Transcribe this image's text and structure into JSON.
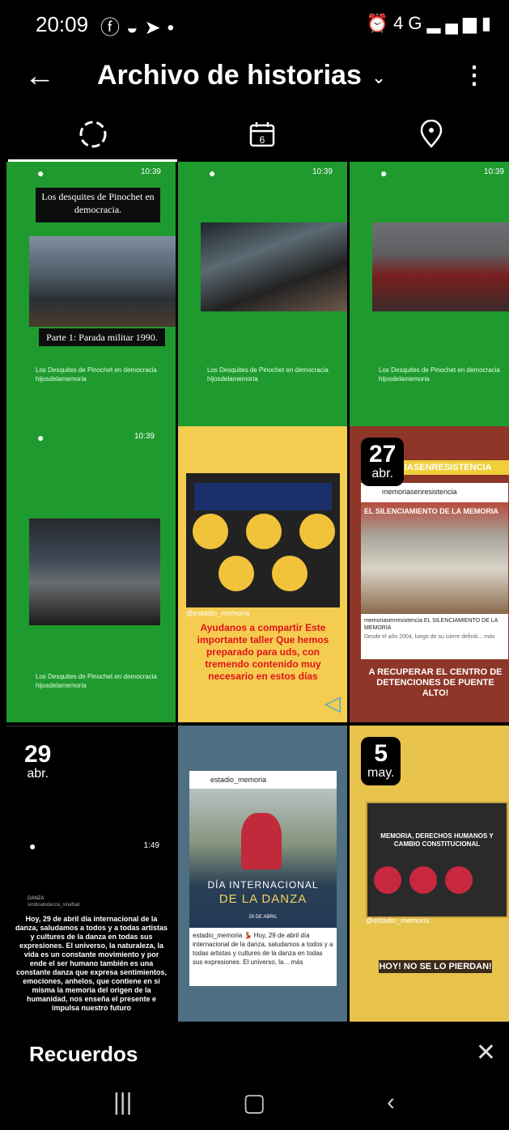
{
  "status": {
    "time": "20:09",
    "left_icons": [
      "facebook-icon",
      "messenger-icon",
      "telegram-icon"
    ],
    "right_icons": [
      "alarm-icon",
      "4g-icon",
      "signal-icon",
      "battery-icon"
    ],
    "net": "4G"
  },
  "appbar": {
    "title": "Archivo de historias"
  },
  "tabs": [
    {
      "name": "stories",
      "icon": "loading-icon"
    },
    {
      "name": "calendar",
      "icon": "calendar-icon",
      "label": "6"
    },
    {
      "name": "map",
      "icon": "location-pin-icon"
    }
  ],
  "grid": {
    "c1": {
      "header": "Los desquites de Pinochet en democracia.",
      "footer": "Parte 1: Parada militar 1990.",
      "caption": "Los Desquites de Pinochet en democracia",
      "user": "hijosdelamemoria",
      "time": "10:39"
    },
    "c2": {
      "caption": "Los Desquites de Pinochet en democracia",
      "user": "hijosdelamemoria",
      "time": "10:39"
    },
    "c3": {
      "caption": "Los Desquites de Pinochet en democracia",
      "user": "hijosdelamemoria",
      "time": "10:39"
    },
    "c4": {
      "caption": "Los Desquites de Pinochet en democracia",
      "user": "hijosdelamemoria",
      "time": "10:39"
    },
    "c5": {
      "user": "@estadio_memoria",
      "text": "Ayudanos a compartir Este importante taller Que hemos preparado para uds, con tremendo contenido muy necesario en estos días"
    },
    "c6": {
      "badge_day": "27",
      "badge_month": "abr.",
      "banner": "RIASENRESISTENCIA",
      "account": "memoriasenresistencia",
      "headline": "EL SILENCIAMIENTO DE LA MEMORIA",
      "bottom": "A RECUPERAR EL CENTRO DE DETENCIONES DE PUENTE ALTO!",
      "desc": "memoriasenresistencia EL SILENCIAMIENTO DE LA MEMORIA",
      "more": "Desde el año 2004, luego de su cierre definiti... más"
    },
    "c7": {
      "badge_day": "29",
      "badge_month": "abr.",
      "time": "1:49",
      "account_name": "DANZA",
      "account": "sindicatodanza_sinattad",
      "text": "Hoy, 29 de abril día internacional de la danza, saludamos a todos y a todas artistas y cultures de la danza en todas sus expresiones. El universo, la naturaleza, la vida es un constante movimiento y por ende el ser humano también es una constante danza que expresa sentimientos, emociones, anhelos, que contiene en sí misma la memoria del origen de la humanidad, nos enseña el presente e impulsa nuestro futuro"
    },
    "c8": {
      "account": "estadio_memoria",
      "title1": "DÍA INTERNACIONAL",
      "title2": "DE LA DANZA",
      "date": "29 DE ABRIL",
      "desc": "estadio_memoria 💃 Hoy, 29 de abril día internacional de la danza, saludamos a todos y a todas artistas y cultures de la danza en todas sus expresiones. El universo, la... más"
    },
    "c9": {
      "badge_day": "5",
      "badge_month": "may.",
      "poster_title": "MEMORIA, DERECHOS HUMANOS Y CAMBIO CONSTITUCIONAL",
      "user": "@estadio_memoria",
      "cta": "HOY! NO SE LO PIERDAN!"
    }
  },
  "bottom": {
    "label": "Recuerdos"
  },
  "nav": [
    "recents-icon",
    "home-icon",
    "back-icon"
  ]
}
